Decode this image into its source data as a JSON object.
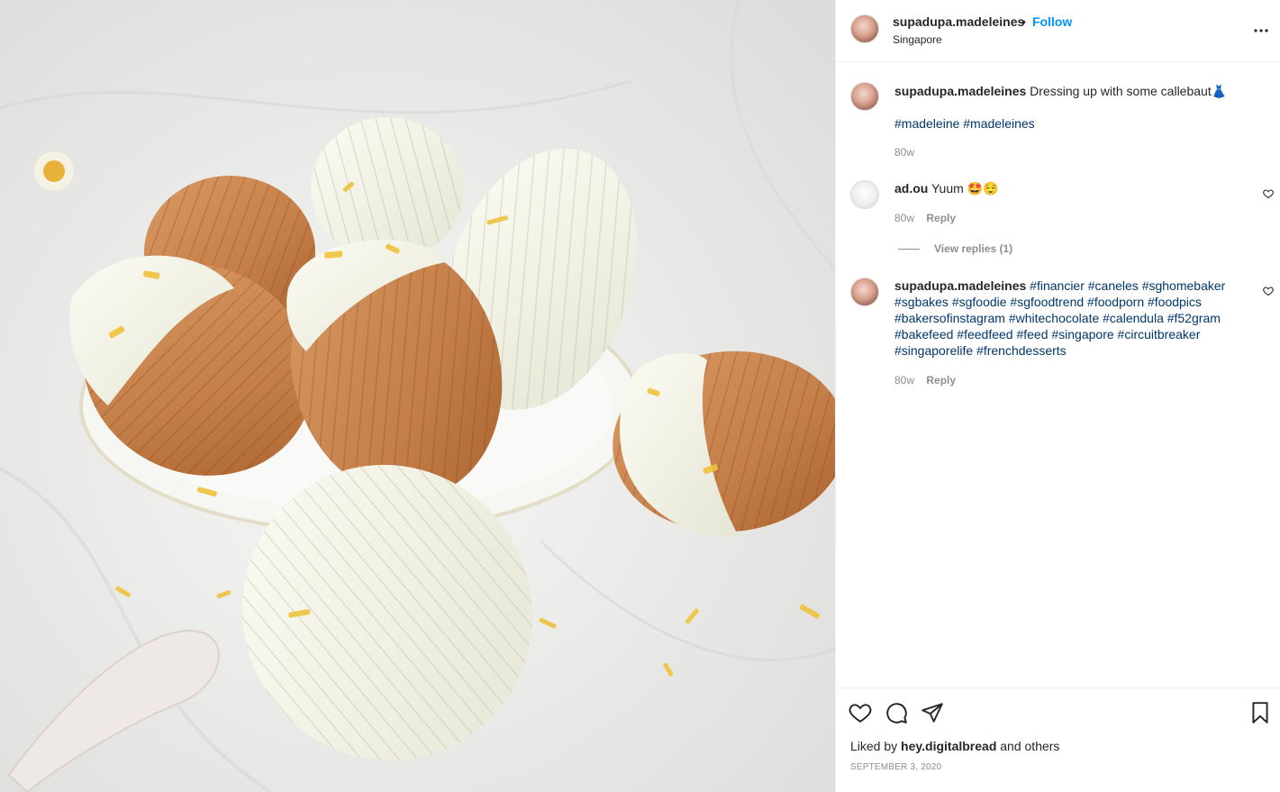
{
  "post": {
    "username": "supadupa.madeleines",
    "separator": "•",
    "follow_label": "Follow",
    "location": "Singapore",
    "more_label": "···"
  },
  "caption": {
    "username": "supadupa.madeleines",
    "text": "Dressing up with some callebaut👗",
    "hashtags": "#madeleine #madeleines",
    "age": "80w"
  },
  "comments": [
    {
      "username": "ad.ou",
      "text": "Yuum 🤩😌",
      "age": "80w",
      "reply_label": "Reply",
      "view_replies_label": "View replies (1)"
    },
    {
      "username": "supadupa.madeleines",
      "lines": [
        "#financier #caneles #sghomebaker",
        "#sgbakes #sgfoodie #sgfoodtrend #foodporn #foodpics",
        "#bakersofinstagram #whitechocolate #calendula #f52gram",
        "#bakefeed #feedfeed #feed #singapore #circuitbreaker",
        "#singaporelife #frenchdesserts"
      ],
      "age": "80w",
      "reply_label": "Reply"
    }
  ],
  "footer": {
    "liked_prefix": "Liked by",
    "liked_user": "hey.digitalbread",
    "liked_suffix": "and others",
    "date": "SEPTEMBER 3, 2020"
  },
  "icons": {
    "like": "heart-icon",
    "comment": "comment-icon",
    "share": "share-icon",
    "save": "bookmark-icon",
    "more": "more-options-icon"
  },
  "colors": {
    "accent": "#0095f6",
    "hashtag": "#00376b",
    "muted": "#8e8e8e",
    "text": "#262626"
  }
}
